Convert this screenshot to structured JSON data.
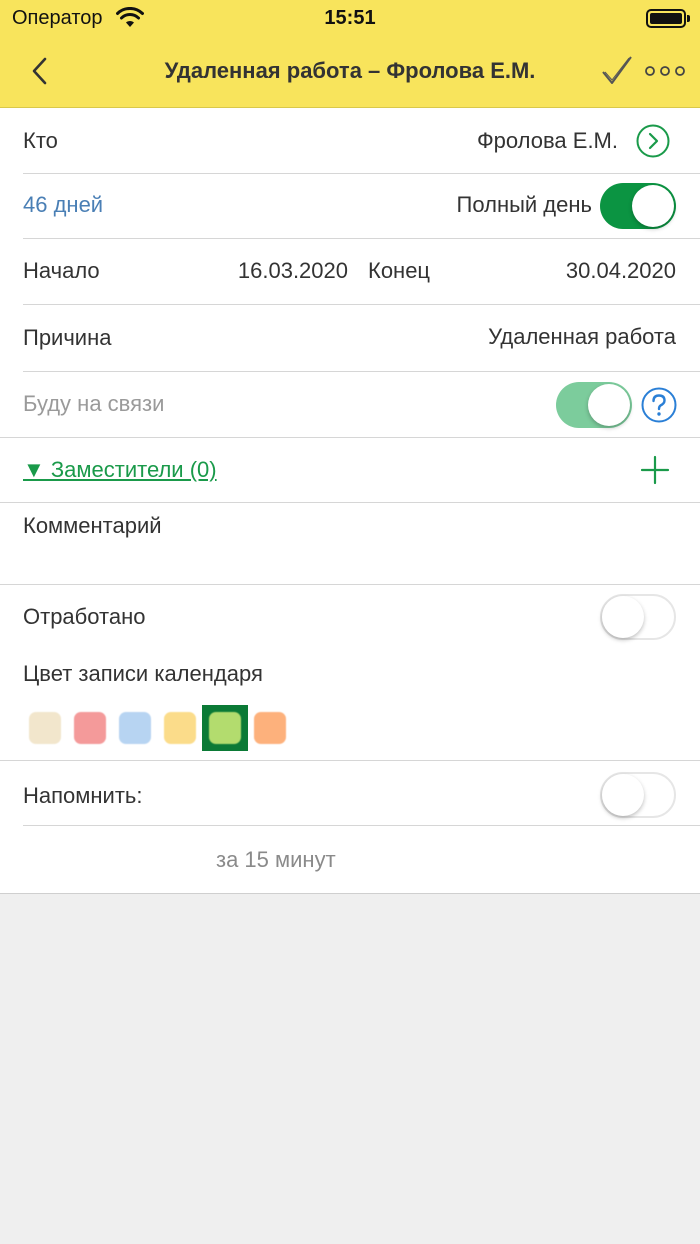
{
  "status_bar": {
    "carrier": "Оператор",
    "time": "15:51"
  },
  "nav": {
    "title": "Удаленная работа – Фролова Е.М.",
    "icons": [
      "back-chevron-icon",
      "check-icon",
      "more-icon"
    ]
  },
  "form": {
    "who_label": "Кто",
    "who_value": "Фролова Е.М.",
    "days": "46 дней",
    "full_day_label": "Полный день",
    "full_day_on": true,
    "start_label": "Начало",
    "start_value": "16.03.2020",
    "end_label": "Конец",
    "end_value": "30.04.2020",
    "reason_label": "Причина",
    "reason_value": "Удаленная работа",
    "reachable_label": "Буду на связи",
    "reachable_on": true,
    "deputies_label": "▼ Заместители (0)",
    "comment_label": "Комментарий",
    "worked_label": "Отработано",
    "worked_on": false,
    "calendar_color_label": "Цвет записи календаря",
    "colors": [
      "#f2e6cc",
      "#f49a9a",
      "#b7d4f2",
      "#fbdc8a",
      "#b3dc6e",
      "#fdb17c"
    ],
    "selected_color_index": 4,
    "remind_label": "Напомнить:",
    "remind_on": false,
    "remind_value": "за 15 минут"
  },
  "theme": {
    "header_bg": "#f8e45c",
    "accent_green": "#0b9442",
    "link_blue": "#4a7fb5"
  }
}
